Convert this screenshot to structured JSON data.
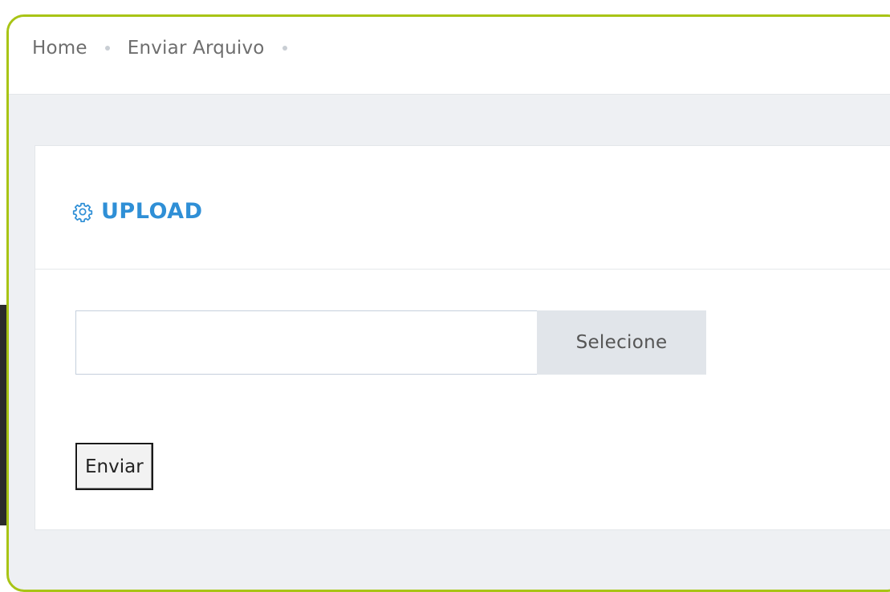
{
  "breadcrumb": {
    "items": [
      "Home",
      "Enviar Arquivo"
    ]
  },
  "panel": {
    "title": "UPLOAD",
    "title_icon": "gear-icon",
    "accent_color": "#2f8fd6"
  },
  "upload_form": {
    "file_input_value": "",
    "select_button_label": "Selecione",
    "submit_button_label": "Enviar"
  },
  "colors": {
    "frame_border": "#a8c415",
    "page_background": "#eef0f3"
  }
}
